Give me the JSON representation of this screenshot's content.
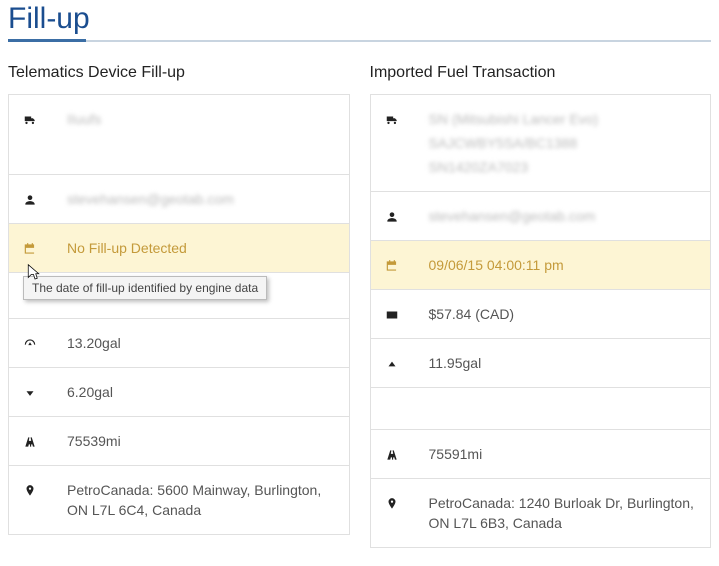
{
  "page": {
    "title": "Fill-up"
  },
  "left": {
    "heading": "Telematics Device Fill-up",
    "vehicle": "IIuufs",
    "driver": "stevehansen@geotab.com",
    "fillup_date": "No Fill-up Detected",
    "fillup_tooltip": "The date of fill-up identified by engine data",
    "fuel_qty": "13.20gal",
    "fuel_delta": "6.20gal",
    "odometer": "75539mi",
    "location": "PetroCanada: 5600 Mainway, Burlington, ON L7L 6C4, Canada"
  },
  "right": {
    "heading": "Imported Fuel Transaction",
    "vehicle_line1": "SN (Mitsubishi Lancer Evo)",
    "vehicle_line2": "SAJCWBY5SA/BC1388",
    "vehicle_line3": "SN1420ZA7023",
    "driver": "stevehansen@geotab.com",
    "fillup_date": "09/06/15 04:00:11 pm",
    "cost": "$57.84 (CAD)",
    "fuel_qty": "11.95gal",
    "odometer": "75591mi",
    "location": "PetroCanada: 1240 Burloak Dr, Burlington, ON L7L 6B3, Canada"
  }
}
